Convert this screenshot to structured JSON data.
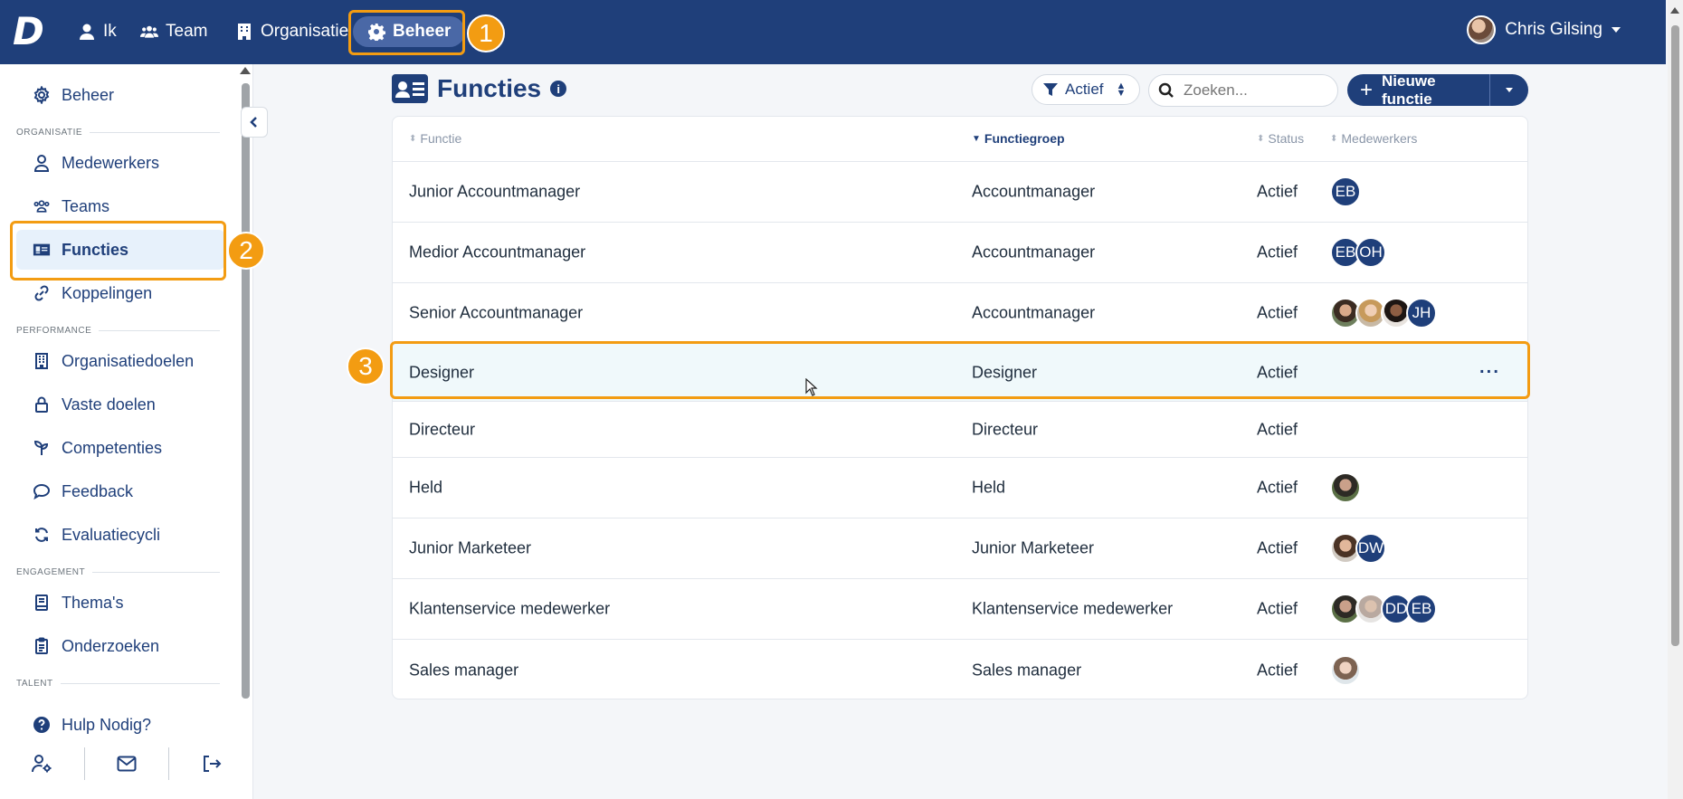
{
  "topnav": {
    "items": [
      {
        "label": "Ik",
        "icon": "user-icon"
      },
      {
        "label": "Team",
        "icon": "users-icon"
      },
      {
        "label": "Organisatie",
        "icon": "building-icon"
      },
      {
        "label": "Beheer",
        "icon": "gear-icon",
        "active": true
      }
    ],
    "user_name": "Chris Gilsing"
  },
  "annotations": [
    "1",
    "2",
    "3"
  ],
  "sidebar": {
    "top_item": "Beheer",
    "sections": {
      "organisatie": "ORGANISATIE",
      "performance": "PERFORMANCE",
      "engagement": "ENGAGEMENT",
      "talent": "TALENT"
    },
    "items": {
      "medewerkers": "Medewerkers",
      "teams": "Teams",
      "functies": "Functies",
      "koppelingen": "Koppelingen",
      "organisatiedoelen": "Organisatiedoelen",
      "vaste_doelen": "Vaste doelen",
      "competenties": "Competenties",
      "feedback": "Feedback",
      "evaluatiecycli": "Evaluatiecycli",
      "themas": "Thema's",
      "onderzoeken": "Onderzoeken"
    },
    "help": "Hulp Nodig?"
  },
  "page": {
    "title": "Functies",
    "filter_label": "Actief",
    "search_placeholder": "Zoeken...",
    "new_button": "Nieuwe functie"
  },
  "table": {
    "columns": [
      "Functie",
      "Functiegroep",
      "Status",
      "Medewerkers"
    ],
    "rows": [
      {
        "functie": "Junior Accountmanager",
        "groep": "Accountmanager",
        "status": "Actief",
        "medewerkers": [
          "EB"
        ]
      },
      {
        "functie": "Medior Accountmanager",
        "groep": "Accountmanager",
        "status": "Actief",
        "medewerkers": [
          "EB",
          "OH"
        ]
      },
      {
        "functie": "Senior Accountmanager",
        "groep": "Accountmanager",
        "status": "Actief",
        "medewerkers": [
          "photo",
          "photo",
          "photo",
          "JH"
        ]
      },
      {
        "functie": "Designer",
        "groep": "Designer",
        "status": "Actief",
        "medewerkers": [],
        "more": "···"
      },
      {
        "functie": "Directeur",
        "groep": "Directeur",
        "status": "Actief",
        "medewerkers": []
      },
      {
        "functie": "Held",
        "groep": "Held",
        "status": "Actief",
        "medewerkers": [
          "photo"
        ]
      },
      {
        "functie": "Junior Marketeer",
        "groep": "Junior Marketeer",
        "status": "Actief",
        "medewerkers": [
          "photo",
          "DW"
        ]
      },
      {
        "functie": "Klantenservice medewerker",
        "groep": "Klantenservice medewerker",
        "status": "Actief",
        "medewerkers": [
          "photo",
          "photo",
          "DD",
          "EB"
        ]
      },
      {
        "functie": "Sales manager",
        "groep": "Sales manager",
        "status": "Actief",
        "medewerkers": [
          "photo"
        ]
      }
    ]
  },
  "colors": {
    "primary": "#1f3f7a",
    "annotation": "#f39c12",
    "hover_row": "#f0f9fb"
  }
}
